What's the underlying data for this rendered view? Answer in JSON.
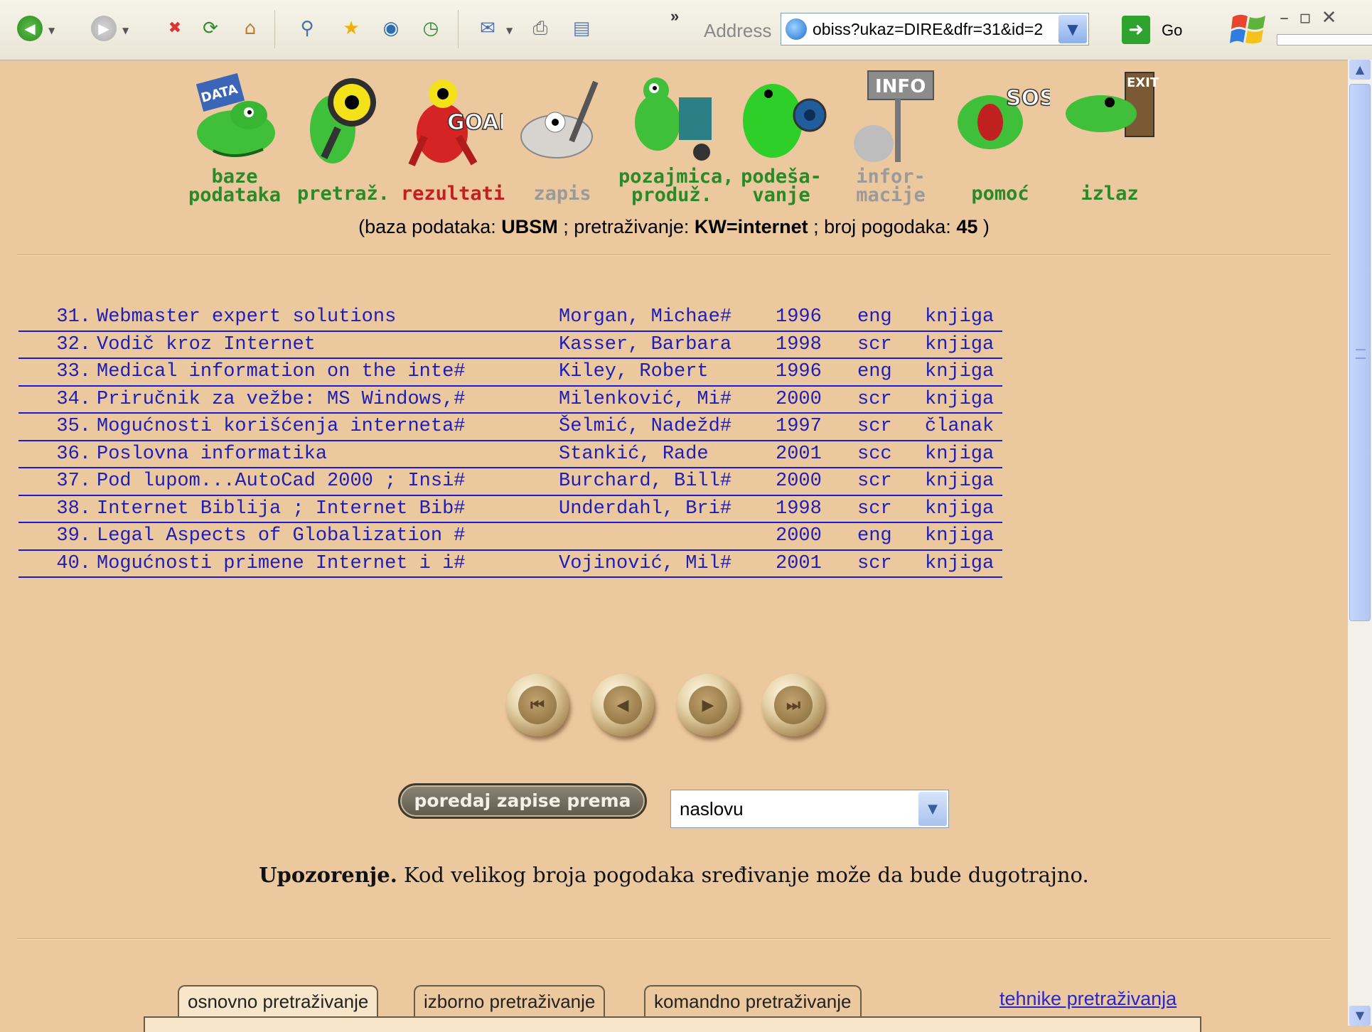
{
  "toolbar": {
    "more": "»",
    "address_label": "Address",
    "address_url": "obiss?ukaz=DIRE&dfr=31&id=2",
    "go_label": "Go",
    "buttons": [
      {
        "name": "back-icon",
        "glyph": "◀"
      },
      {
        "name": "forward-icon",
        "glyph": "▶"
      },
      {
        "name": "stop-icon",
        "glyph": "✖"
      },
      {
        "name": "refresh-icon",
        "glyph": "⟳"
      },
      {
        "name": "home-icon",
        "glyph": "⌂"
      },
      {
        "name": "search-icon",
        "glyph": "⚲"
      },
      {
        "name": "favorites-icon",
        "glyph": "★"
      },
      {
        "name": "media-icon",
        "glyph": "◉"
      },
      {
        "name": "history-icon",
        "glyph": "◷"
      },
      {
        "name": "mail-icon",
        "glyph": "✉"
      },
      {
        "name": "print-icon",
        "glyph": "⎙"
      },
      {
        "name": "edit-icon",
        "glyph": "▤"
      }
    ]
  },
  "nav": {
    "items": [
      {
        "label": "baze\npodataka",
        "color": "green",
        "icon": "database-frog-icon"
      },
      {
        "label": "pretraž.",
        "color": "green",
        "icon": "search-frog-icon"
      },
      {
        "label": "rezultati",
        "color": "red",
        "icon": "goal-frog-icon"
      },
      {
        "label": "zapis",
        "color": "grey",
        "icon": "record-frog-icon"
      },
      {
        "label": "pozajmica,\nproduž.",
        "color": "green",
        "icon": "loan-frog-icon"
      },
      {
        "label": "podeša-\nvanje",
        "color": "green",
        "icon": "settings-frog-icon"
      },
      {
        "label": "infor-\nmacije",
        "color": "grey",
        "icon": "info-frog-icon"
      },
      {
        "label": "pomoć",
        "color": "green",
        "icon": "help-frog-icon"
      },
      {
        "label": "izlaz",
        "color": "green",
        "icon": "exit-frog-icon"
      }
    ],
    "summary": {
      "db_prefix": "(baza podataka: ",
      "db_value": "UBSM",
      "search_prefix": " ; pretraživanje: ",
      "search_value": "KW=internet",
      "hits_prefix": " ; broj pogodaka: ",
      "hits_value": "45",
      "suffix": " )"
    }
  },
  "results": [
    {
      "num": "31.",
      "title": "Webmaster expert solutions",
      "author": "Morgan, Michae#",
      "year": "1996",
      "lang": "eng",
      "type": "knjiga"
    },
    {
      "num": "32.",
      "title": "Vodič kroz Internet",
      "author": "Kasser, Barbara",
      "year": "1998",
      "lang": "scr",
      "type": "knjiga"
    },
    {
      "num": "33.",
      "title": "Medical information on the inte#",
      "author": "Kiley, Robert",
      "year": "1996",
      "lang": "eng",
      "type": "knjiga"
    },
    {
      "num": "34.",
      "title": "Priručnik za vežbe: MS Windows,#",
      "author": "Milenković, Mi#",
      "year": "2000",
      "lang": "scr",
      "type": "knjiga"
    },
    {
      "num": "35.",
      "title": "Mogućnosti korišćenja interneta#",
      "author": "Šelmić, Nadežd#",
      "year": "1997",
      "lang": "scr",
      "type": "članak"
    },
    {
      "num": "36.",
      "title": "Poslovna informatika",
      "author": "Stankić, Rade",
      "year": "2001",
      "lang": "scc",
      "type": "knjiga"
    },
    {
      "num": "37.",
      "title": "Pod lupom...AutoCad 2000 ; Insi#",
      "author": "Burchard, Bill#",
      "year": "2000",
      "lang": "scr",
      "type": "knjiga"
    },
    {
      "num": "38.",
      "title": "Internet Biblija ; Internet Bib#",
      "author": "Underdahl, Bri#",
      "year": "1998",
      "lang": "scr",
      "type": "knjiga"
    },
    {
      "num": "39.",
      "title": "Legal Aspects of Globalization #",
      "author": "",
      "year": "2000",
      "lang": "eng",
      "type": "knjiga"
    },
    {
      "num": "40.",
      "title": "Mogućnosti primene Internet i i#",
      "author": "Vojinović, Mil#",
      "year": "2001",
      "lang": "scr",
      "type": "knjiga"
    }
  ],
  "paging": [
    {
      "name": "first-page-icon",
      "glyph": "⏮"
    },
    {
      "name": "previous-page-icon",
      "glyph": "◀"
    },
    {
      "name": "next-page-icon",
      "glyph": "▶"
    },
    {
      "name": "last-page-icon",
      "glyph": "⏭"
    }
  ],
  "sort": {
    "button_label": "poredaj zapise prema",
    "selected": "naslovu"
  },
  "warning": {
    "bold": "Upozorenje.",
    "text": " Kod velikog broja pogodaka sređivanje može da bude dugotrajno."
  },
  "tabs": [
    {
      "label": "osnovno pretraživanje",
      "active": true
    },
    {
      "label": "izborno pretraživanje",
      "active": false
    },
    {
      "label": "komandno pretraživanje",
      "active": false
    }
  ],
  "tech_link": "tehnike pretraživanja"
}
